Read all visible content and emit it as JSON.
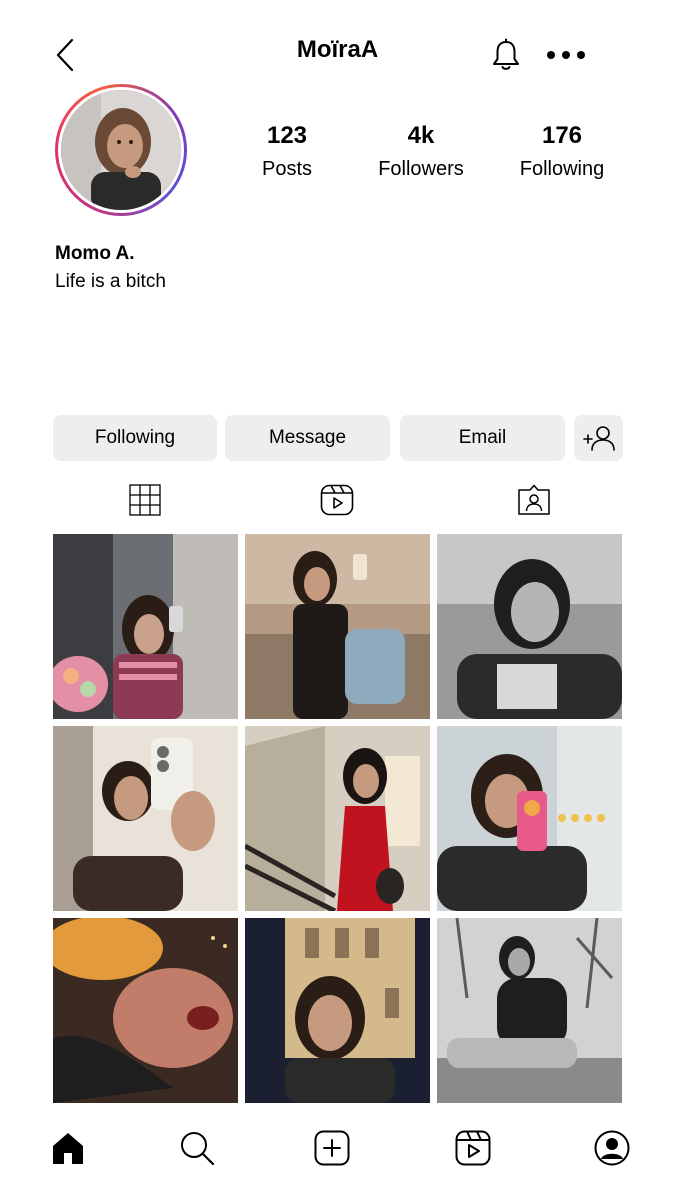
{
  "header": {
    "title": "MoïraA",
    "back_icon": "chevron-left-icon",
    "notifications_icon": "bell-icon",
    "more_icon": "more-horizontal-icon"
  },
  "profile": {
    "stats": {
      "posts": {
        "value": "123",
        "label": "Posts"
      },
      "followers": {
        "value": "4k",
        "label": "Followers"
      },
      "following": {
        "value": "176",
        "label": "Following"
      }
    },
    "display_name": "Momo A.",
    "bio": "Life is a bitch",
    "avatar_ring_colors": [
      "#c13584",
      "#e1306c",
      "#833ab4"
    ]
  },
  "actions": {
    "following_label": "Following",
    "message_label": "Message",
    "email_label": "Email",
    "add_friend_icon": "add-person-icon"
  },
  "tabs": [
    {
      "icon": "grid-icon",
      "active": true
    },
    {
      "icon": "reels-icon",
      "active": false
    },
    {
      "icon": "tagged-icon",
      "active": false
    }
  ],
  "posts": [
    {
      "tone": "color",
      "palette": [
        "#6b6e72",
        "#c9b6aa",
        "#8d3a55",
        "#e58fa6"
      ]
    },
    {
      "tone": "color",
      "palette": [
        "#b49a82",
        "#2a2422",
        "#8d7966",
        "#6a8ea8"
      ]
    },
    {
      "tone": "mono",
      "palette": [
        "#9a9a9a",
        "#2b2b2b",
        "#d8d8d8",
        "#4a4a4a"
      ]
    },
    {
      "tone": "color",
      "palette": [
        "#e8e2d8",
        "#3a2c24",
        "#f1efe9",
        "#8a6e58"
      ]
    },
    {
      "tone": "color",
      "palette": [
        "#d6cfc1",
        "#c1121f",
        "#2a2522",
        "#f2e8d3"
      ]
    },
    {
      "tone": "color",
      "palette": [
        "#cbd3d6",
        "#2b2b2b",
        "#f0a84b",
        "#e85a8a"
      ]
    },
    {
      "tone": "color",
      "palette": [
        "#3a2a22",
        "#e39a3c",
        "#c27d6a",
        "#1e1e1e"
      ]
    },
    {
      "tone": "color",
      "palette": [
        "#1a2032",
        "#d4b98a",
        "#6b5b4a",
        "#2a2a2a"
      ]
    },
    {
      "tone": "mono",
      "palette": [
        "#d2d2d2",
        "#1e1e1e",
        "#8a8a8a",
        "#5a5a5a"
      ]
    }
  ],
  "bottom_nav": [
    {
      "icon": "home-icon",
      "active": true
    },
    {
      "icon": "search-icon",
      "active": false
    },
    {
      "icon": "create-post-icon",
      "active": false
    },
    {
      "icon": "reels-icon",
      "active": false
    },
    {
      "icon": "profile-icon",
      "active": false
    }
  ]
}
